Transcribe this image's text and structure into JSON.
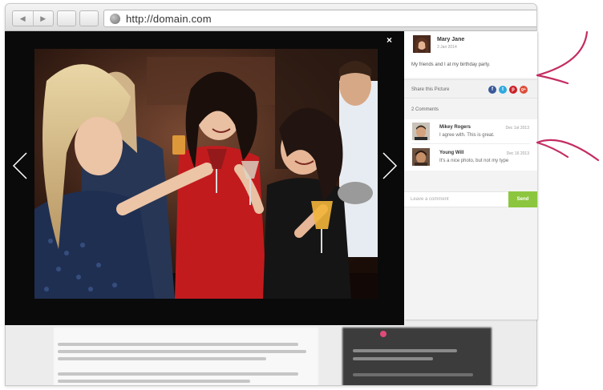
{
  "browser": {
    "url": "http://domain.com",
    "back_icon": "back-arrow-icon",
    "forward_icon": "forward-arrow-icon",
    "globe_icon": "globe-icon"
  },
  "lightbox": {
    "close_label": "×",
    "prev_icon": "chevron-left-icon",
    "next_icon": "chevron-right-icon"
  },
  "post": {
    "author": "Mary Jane",
    "date": "3 Jan 2014",
    "caption": "My friends and I at my birthday party."
  },
  "share": {
    "label": "Share this Picture",
    "networks": [
      {
        "name": "facebook",
        "glyph": "f",
        "color": "#3b5998"
      },
      {
        "name": "twitter",
        "glyph": "t",
        "color": "#2fa9e0"
      },
      {
        "name": "pinterest",
        "glyph": "p",
        "color": "#cb2027"
      },
      {
        "name": "google-plus",
        "glyph": "g+",
        "color": "#dd4b39"
      }
    ]
  },
  "comments": {
    "count_label": "2 Comments",
    "items": [
      {
        "name": "Mikey Rogers",
        "date": "Dec 1st 2013",
        "text": "I agree with. This is great."
      },
      {
        "name": "Young Will",
        "date": "Dec 16 2013",
        "text": "It's a nice photo, but not my type"
      }
    ],
    "input_placeholder": "Leave a comment",
    "send_label": "Send"
  },
  "colors": {
    "accent_send": "#8cc63f",
    "annotation": "#c42d63"
  }
}
